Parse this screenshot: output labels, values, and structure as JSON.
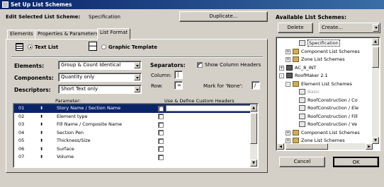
{
  "title": "Set Up List Schemes",
  "header": {
    "edit_label": "Edit Selected List Scheme:",
    "scheme_name": "Specification",
    "duplicate_label": "Duplicate..."
  },
  "tabs": [
    {
      "label": "Elements"
    },
    {
      "label": "Properties & Parameters"
    },
    {
      "label": "List Format"
    }
  ],
  "format": {
    "text_list_label": "Text List",
    "graphic_template_label": "Graphic Template",
    "selected": "Text List"
  },
  "elements": {
    "label": "Elements:",
    "value": "Group & Count Identical"
  },
  "components": {
    "label": "Components:",
    "value": "Quantity only"
  },
  "descriptors": {
    "label": "Descriptors:",
    "value": "Short Text only"
  },
  "separators": {
    "label": "Separators:",
    "show_headers_label": "Show Column Headers",
    "show_headers_checked": true,
    "column_label": "Column:",
    "column_value": "|",
    "row_label": "Row:",
    "row_value": "=",
    "mark_none_label": "Mark for 'None':",
    "mark_none_value": "/"
  },
  "table": {
    "col_param": "Parameter:",
    "col_custom": "Use & Define Custom Headers",
    "rows": [
      {
        "num": "01",
        "name": "Story Name / Section Name",
        "checked": true,
        "selected": true
      },
      {
        "num": "02",
        "name": "Element type",
        "checked": false
      },
      {
        "num": "03",
        "name": "Fill Name / Composite Name",
        "checked": false
      },
      {
        "num": "04",
        "name": "Section Pen",
        "checked": false
      },
      {
        "num": "05",
        "name": "Thickness/Size",
        "checked": false
      },
      {
        "num": "06",
        "name": "Surface",
        "checked": false
      },
      {
        "num": "07",
        "name": "Volume",
        "checked": false
      }
    ]
  },
  "available": {
    "label": "Available List Schemes:",
    "delete_label": "Delete",
    "create_label": "Create...",
    "tree": [
      {
        "text": "Specification",
        "level": 2,
        "toggle": "",
        "icon": "doc",
        "selected": true
      },
      {
        "text": "Component List Schemes",
        "level": 1,
        "toggle": "+",
        "icon": "folder"
      },
      {
        "text": "Zone List Schemes",
        "level": 1,
        "toggle": "+",
        "icon": "folder"
      },
      {
        "text": "AC_8_INT",
        "level": 0,
        "toggle": "+",
        "icon": "db"
      },
      {
        "text": "RoofMaker 2.1",
        "level": 0,
        "toggle": "-",
        "icon": "db"
      },
      {
        "text": "Element List Schemes",
        "level": 1,
        "toggle": "-",
        "icon": "folder"
      },
      {
        "text": "Basic",
        "level": 2,
        "toggle": "",
        "icon": "doc",
        "disabled": true
      },
      {
        "text": "RoofConstruction / Co",
        "level": 2,
        "toggle": "",
        "icon": "doc"
      },
      {
        "text": "RoofConstruction / Ele",
        "level": 2,
        "toggle": "",
        "icon": "doc"
      },
      {
        "text": "RoofConstruction / Fill",
        "level": 2,
        "toggle": "",
        "icon": "doc"
      },
      {
        "text": "RoofConstruction / Ve",
        "level": 2,
        "toggle": "",
        "icon": "doc"
      },
      {
        "text": "Component List Schemes",
        "level": 1,
        "toggle": "+",
        "icon": "folder"
      },
      {
        "text": "Zone List Schemes",
        "level": 1,
        "toggle": "+",
        "icon": "folder"
      }
    ]
  },
  "footer": {
    "cancel_label": "Cancel",
    "ok_label": "OK"
  }
}
